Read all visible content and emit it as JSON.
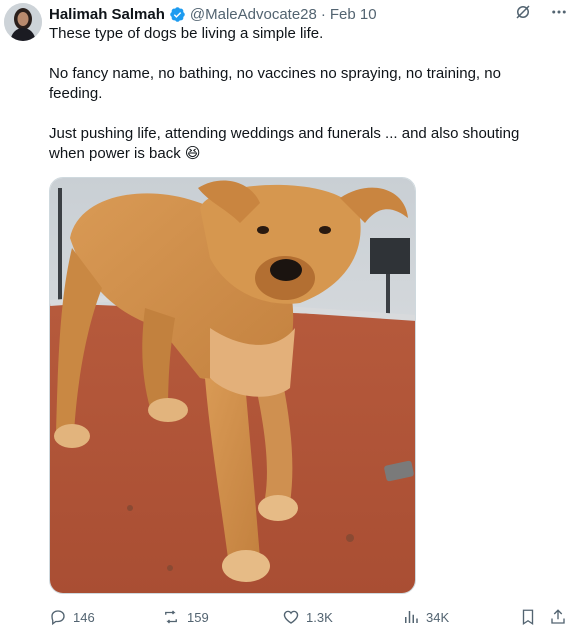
{
  "author": {
    "name": "Halimah Salmah",
    "handle": "@MaleAdvocate28",
    "separator": "·",
    "date": "Feb 10"
  },
  "icons": {
    "verified": "verified-badge-icon",
    "grok": "grok-icon",
    "more": "more-options-icon",
    "reply": "reply-icon",
    "retweet": "retweet-icon",
    "like": "like-icon",
    "views": "views-icon",
    "bookmark": "bookmark-icon",
    "share": "share-icon"
  },
  "colors": {
    "verified": "#1d9bf0",
    "text": "#0f1419",
    "muted": "#536471"
  },
  "tweet": {
    "line1": "These type of dogs be living a simple life.",
    "line2": "No fancy name, no bathing, no vaccines no spraying, no training, no feeding.",
    "line3": "Just pushing life, attending weddings and funerals ... and also shouting when power is back 😆"
  },
  "stats": {
    "replies": "146",
    "retweets": "159",
    "likes": "1.3K",
    "views": "34K"
  }
}
